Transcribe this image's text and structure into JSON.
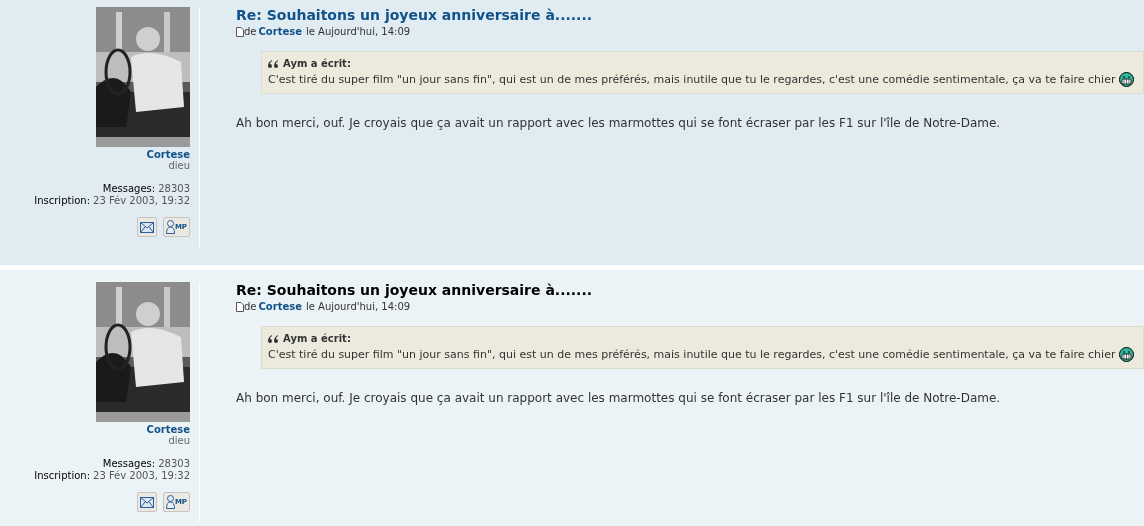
{
  "posts": [
    {
      "highlighted": true,
      "author": {
        "name": "Cortese",
        "rank": "dieu",
        "stats": [
          {
            "label": "Messages:",
            "value": "28303"
          },
          {
            "label": "Inscription:",
            "value": "23 Fév 2003, 19:32"
          }
        ],
        "pm_label": "MP"
      },
      "title": "Re: Souhaitons un joyeux anniversaire à.......",
      "byline": {
        "prefix": "de",
        "author": "Cortese",
        "date": "le Aujourd'hui, 14:09"
      },
      "quote": {
        "cite": "Aym a écrit:",
        "text": "C'est tiré du super film \"un jour sans fin\", qui est un de mes préférés, mais inutile que tu le regardes, c'est une comédie sentimentale, ça va te faire chier"
      },
      "body": "Ah bon merci, ouf. Je croyais que ça avait un rapport avec les marmottes qui se font écraser par les F1 sur l'île de Notre-Dame."
    },
    {
      "highlighted": false,
      "author": {
        "name": "Cortese",
        "rank": "dieu",
        "stats": [
          {
            "label": "Messages:",
            "value": "28303"
          },
          {
            "label": "Inscription:",
            "value": "23 Fév 2003, 19:32"
          }
        ],
        "pm_label": "MP"
      },
      "title": "Re: Souhaitons un joyeux anniversaire à.......",
      "byline": {
        "prefix": "de",
        "author": "Cortese",
        "date": "le Aujourd'hui, 14:09"
      },
      "quote": {
        "cite": "Aym a écrit:",
        "text": "C'est tiré du super film \"un jour sans fin\", qui est un de mes préférés, mais inutile que tu le regardes, c'est une comédie sentimentale, ça va te faire chier"
      },
      "body": "Ah bon merci, ouf. Je croyais que ça avait un rapport avec les marmottes qui se font écraser par les F1 sur l'île de Notre-Dame."
    }
  ]
}
